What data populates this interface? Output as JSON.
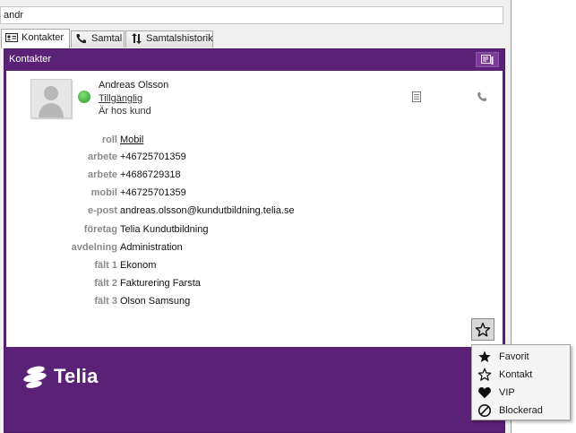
{
  "search": {
    "value": "andr"
  },
  "tabs": [
    {
      "label": "Kontakter",
      "icon": "contact-card-icon",
      "active": true
    },
    {
      "label": "Samtal",
      "icon": "phone-icon",
      "active": false
    },
    {
      "label": "Samtalshistorik",
      "icon": "history-arrows-icon",
      "active": false
    }
  ],
  "panel": {
    "title": "Kontakter",
    "header_button_icon": "vcard-icon"
  },
  "contact": {
    "name": "Andreas Olsson",
    "status": "Tillgänglig",
    "note": "Är hos kund",
    "status_color": "#3fb53a"
  },
  "fields": [
    {
      "label": "roll",
      "value": "Mobil"
    },
    {
      "label": "arbete",
      "value": "+46725701359"
    },
    {
      "label": "arbete",
      "value": "+4686729318"
    },
    {
      "label": "mobil",
      "value": "+46725701359"
    },
    {
      "label": "e-post",
      "value": "andreas.olsson@kundutbildning.telia.se"
    },
    {
      "label": "företag",
      "value": "Telia Kundutbildning"
    },
    {
      "label": "avdelning",
      "value": "Administration"
    },
    {
      "label": "fält 1",
      "value": "Ekonom"
    },
    {
      "label": "fält 2",
      "value": "Fakturering Farsta"
    },
    {
      "label": "fält 3",
      "value": "Olson Samsung"
    }
  ],
  "brand": {
    "logo_text": "Telia",
    "color": "#5a2277"
  },
  "menu": {
    "items": [
      {
        "label": "Favorit",
        "icon": "star-filled-icon"
      },
      {
        "label": "Kontakt",
        "icon": "star-outline-icon"
      },
      {
        "label": "VIP",
        "icon": "heart-icon"
      },
      {
        "label": "Blockerad",
        "icon": "blocked-icon"
      }
    ]
  }
}
